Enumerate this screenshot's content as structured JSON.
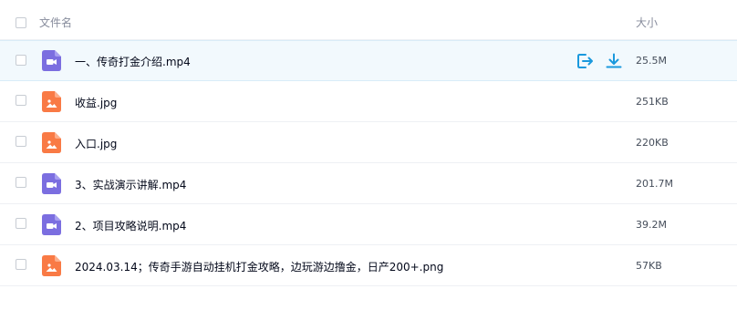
{
  "header": {
    "name_label": "文件名",
    "size_label": "大小"
  },
  "colors": {
    "video_icon": "#7b6ee0",
    "image_icon": "#f97a45",
    "action_icon": "#1a99dd",
    "active_row_bg": "#f2f9fd"
  },
  "files": [
    {
      "name": "一、传奇打金介绍.mp4",
      "size": "25.5M",
      "type": "video",
      "icon": "video-file-icon"
    },
    {
      "name": "收益.jpg",
      "size": "251KB",
      "type": "image",
      "icon": "image-file-icon"
    },
    {
      "name": "入口.jpg",
      "size": "220KB",
      "type": "image",
      "icon": "image-file-icon"
    },
    {
      "name": "3、实战演示讲解.mp4",
      "size": "201.7M",
      "type": "video",
      "icon": "video-file-icon"
    },
    {
      "name": "2、项目攻略说明.mp4",
      "size": "39.2M",
      "type": "video",
      "icon": "video-file-icon"
    },
    {
      "name": "2024.03.14；传奇手游自动挂机打金攻略，边玩游边撸金，日产200+.png",
      "size": "57KB",
      "type": "image",
      "icon": "image-file-icon"
    }
  ],
  "row_actions": [
    {
      "name": "open-icon"
    },
    {
      "name": "download-icon"
    }
  ]
}
